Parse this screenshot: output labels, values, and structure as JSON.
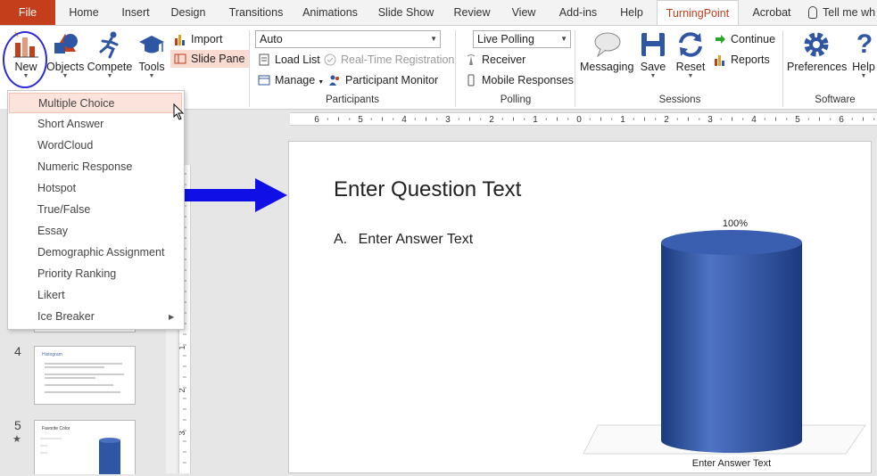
{
  "tabs": [
    "File",
    "Home",
    "Insert",
    "Design",
    "Transitions",
    "Animations",
    "Slide Show",
    "Review",
    "View",
    "Add-ins",
    "Help",
    "TurningPoint",
    "Acrobat",
    "Tell me wh"
  ],
  "ribbon": {
    "new": "New",
    "objects": "Objects",
    "compete": "Compete",
    "tools": "Tools",
    "import": "Import",
    "slide_pane": "Slide Pane",
    "combo_auto": "Auto",
    "load_list": "Load List",
    "realtime": "Real-Time Registration",
    "manage": "Manage",
    "participant_monitor": "Participant Monitor",
    "combo_polling": "Live Polling",
    "receiver": "Receiver",
    "mobile": "Mobile Responses",
    "messaging": "Messaging",
    "save": "Save",
    "reset": "Reset",
    "continue": "Continue",
    "reports": "Reports",
    "preferences": "Preferences",
    "help": "Help",
    "groups": {
      "participants": "Participants",
      "polling": "Polling",
      "sessions": "Sessions",
      "software": "Software"
    }
  },
  "menu": [
    "Multiple Choice",
    "Short Answer",
    "WordCloud",
    "Numeric Response",
    "Hotspot",
    "True/False",
    "Essay",
    "Demographic Assignment",
    "Priority Ranking",
    "Likert",
    "Ice Breaker"
  ],
  "ruler": {
    "h_labels": [
      "6",
      "5",
      "4",
      "3",
      "2",
      "1",
      "0",
      "1",
      "2",
      "3",
      "4",
      "5",
      "6"
    ],
    "v_labels": [
      "1",
      "2",
      "3"
    ]
  },
  "slides": [
    {
      "num": "4",
      "title": "Histogram"
    },
    {
      "num": "5",
      "title": "Favorite Color",
      "star": "★"
    }
  ],
  "slide": {
    "question": "Enter Question Text",
    "answer_letter": "A.",
    "answer": "Enter Answer Text",
    "bar_pct": "100%",
    "bar_value": 100,
    "bar_label": "Enter Answer Text"
  },
  "colors": {
    "accent": "#c43e1c",
    "bar": "#2f56a3",
    "arrow": "#1010e6",
    "circle": "#2a2ad6"
  }
}
